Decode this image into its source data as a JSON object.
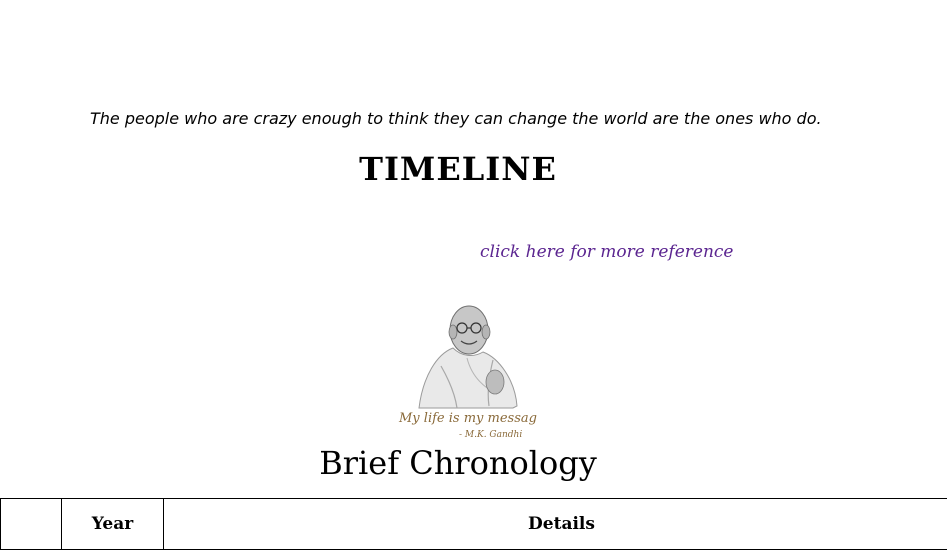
{
  "quote": {
    "text": "The people who are crazy enough to think they can change the world are the ones who do."
  },
  "heading": {
    "title": "TIMELINE"
  },
  "reference": {
    "link_text": "click here for more reference"
  },
  "portrait": {
    "caption_line1": "My life is my message.",
    "caption_line2": "- M.K. Gandhi"
  },
  "chronology": {
    "title": "Brief Chronology"
  },
  "table": {
    "headers": [
      "",
      "Year",
      "Details"
    ]
  },
  "colors": {
    "link": "#5b2590",
    "caption": "#8a6a3a"
  }
}
